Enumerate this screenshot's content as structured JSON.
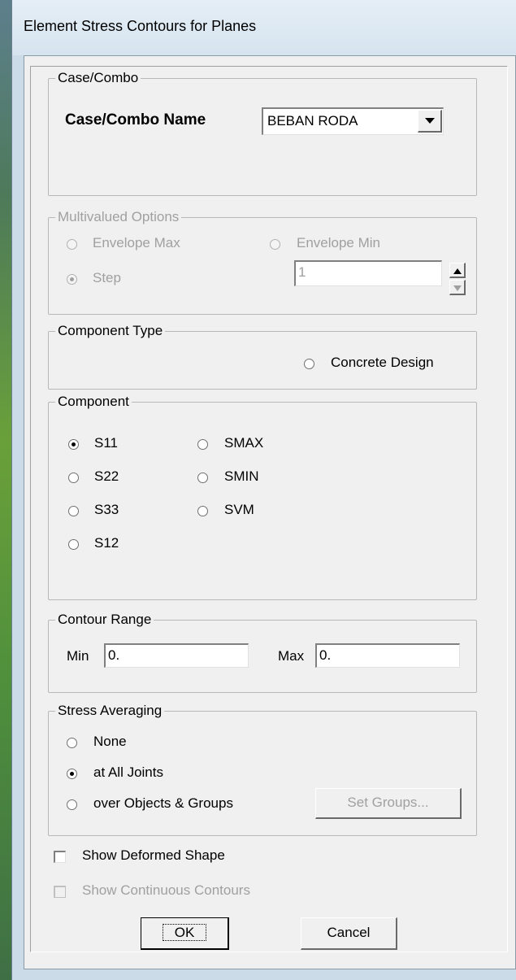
{
  "window": {
    "title": "Element Stress Contours for Planes"
  },
  "case_combo": {
    "legend": "Case/Combo",
    "name_label": "Case/Combo Name",
    "selected": "BEBAN RODA",
    "icons": {
      "dropdown": "chevron-down-icon"
    }
  },
  "multivalued": {
    "legend": "Multivalued Options",
    "envelope_max": "Envelope Max",
    "envelope_min": "Envelope Min",
    "step": "Step",
    "step_value": "1",
    "step_selected": true,
    "enabled": false
  },
  "component_type": {
    "legend": "Component Type",
    "concrete_design": "Concrete Design"
  },
  "component": {
    "legend": "Component",
    "options": [
      "S11",
      "S22",
      "S33",
      "S12",
      "SMAX",
      "SMIN",
      "SVM"
    ],
    "selected": "S11"
  },
  "contour_range": {
    "legend": "Contour Range",
    "min_label": "Min",
    "min_value": "0.",
    "max_label": "Max",
    "max_value": "0."
  },
  "stress_averaging": {
    "legend": "Stress Averaging",
    "options": [
      "None",
      "at All Joints",
      "over Objects & Groups"
    ],
    "selected": "at All Joints",
    "set_groups_label": "Set Groups..."
  },
  "checkboxes": {
    "show_deformed_shape": "Show Deformed Shape",
    "show_deformed_checked": false,
    "show_continuous_contours": "Show Continuous Contours",
    "show_continuous_checked": false
  },
  "buttons": {
    "ok": "OK",
    "cancel": "Cancel"
  }
}
